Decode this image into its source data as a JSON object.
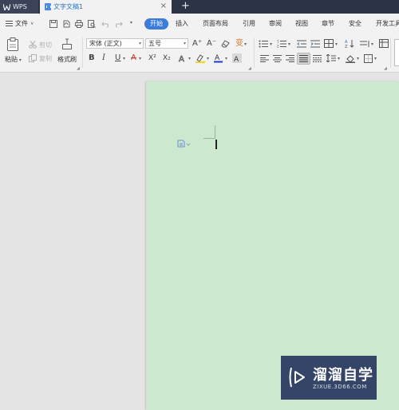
{
  "titlebar": {
    "app_tab": "WPS",
    "doc_tab": "文字文稿1",
    "close_glyph": "×",
    "new_tab_glyph": "+"
  },
  "menubar": {
    "file_label": "文件",
    "file_caret": "∨",
    "tabs": [
      "开始",
      "插入",
      "页面布局",
      "引用",
      "审阅",
      "视图",
      "章节",
      "安全",
      "开发工具"
    ],
    "active_tab": "开始"
  },
  "ribbon": {
    "paste_label": "粘贴",
    "cut_label": "剪切",
    "copy_label": "复制",
    "format_painter_label": "格式刷",
    "font_name": "宋体 (正文)",
    "font_size": "五号",
    "bold": "B",
    "italic": "I",
    "underline": "U",
    "strike_a": "A",
    "superscript": "X²",
    "subscript": "X₂",
    "grow_font": "A⁺",
    "shrink_font": "A⁻",
    "phonetic": "变"
  },
  "watermark": {
    "title": "溜溜自学",
    "subtitle": "ZIXUE.3D66.COM"
  },
  "colors": {
    "title_bg": "#2b3447",
    "accent": "#3a7bdc",
    "page_bg": "#cce8cf",
    "canvas_bg": "#e4e4e4"
  }
}
